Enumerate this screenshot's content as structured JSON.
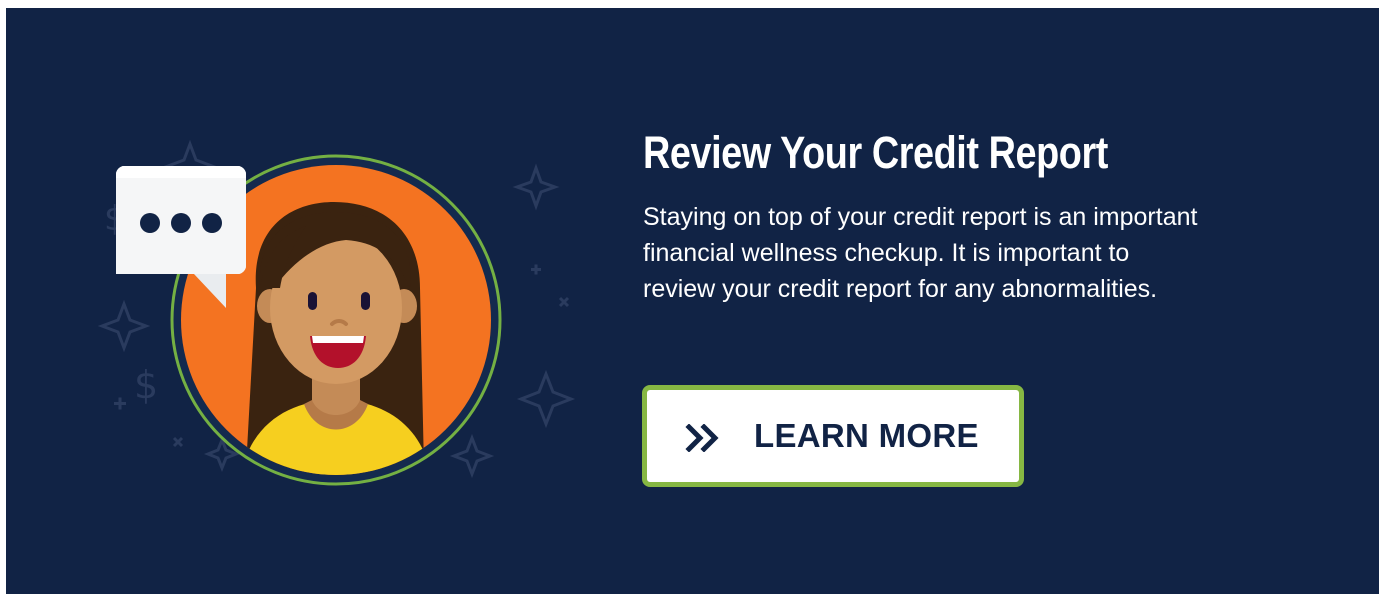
{
  "banner": {
    "background_color": "#112345",
    "illustration": {
      "name": "woman-avatar-with-speech-bubble",
      "speech_bubble_icon": "ellipsis-speech-bubble-icon",
      "avatar_ring_color": "#74b043",
      "avatar_background_color": "#f47321"
    },
    "headline": "Review Your Credit Report",
    "description_lines": [
      "Staying on top of your credit report is an important",
      "financial wellness checkup. It is important to",
      "review your credit report for any abnormalities."
    ],
    "cta": {
      "label": "LEARN MORE",
      "icon": "double-chevron-right-icon",
      "border_color": "#86b743",
      "text_color": "#112345"
    }
  }
}
